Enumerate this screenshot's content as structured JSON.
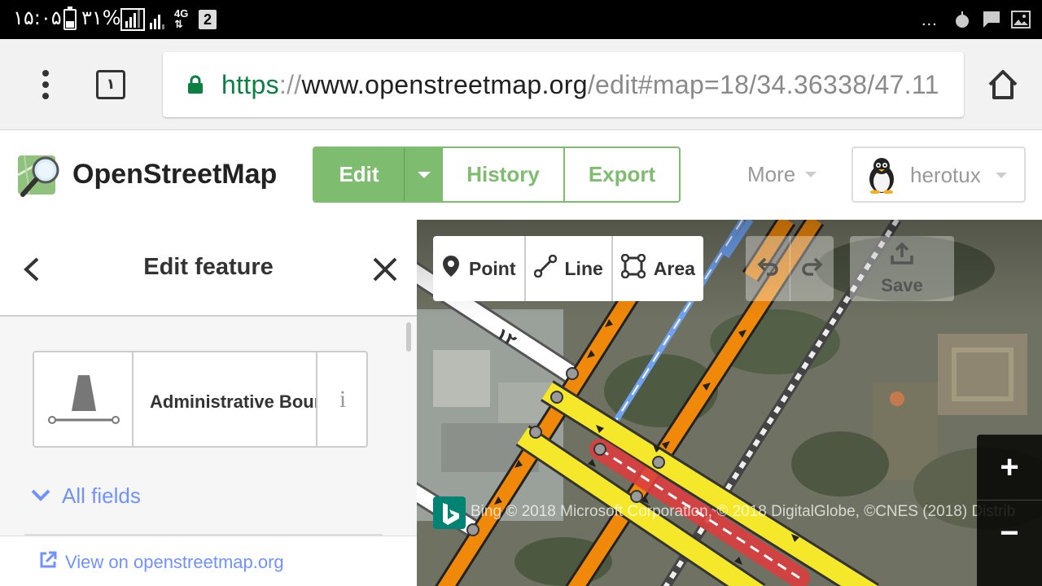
{
  "status_bar": {
    "time": "۱۵:۰۵",
    "battery": "۳۱%",
    "network": "4G",
    "sim_slot": "2",
    "overflow": "..."
  },
  "browser": {
    "tab_count": "۱",
    "url": {
      "scheme": "https",
      "separator": "://",
      "host": "www.openstreetmap.org",
      "path": "/edit#map=18/34.36338/47.11"
    }
  },
  "osm_header": {
    "site_title": "OpenStreetMap",
    "edit_label": "Edit",
    "history_label": "History",
    "export_label": "Export",
    "more_label": "More",
    "username": "herotux"
  },
  "sidebar": {
    "title": "Edit feature",
    "preset_name": "Administrative Boundary",
    "preset_info": "i",
    "all_fields_label": "All fields",
    "view_on_label": "View on openstreetmap.org"
  },
  "map": {
    "point_label": "Point",
    "line_label": "Line",
    "area_label": "Area",
    "save_label": "Save",
    "zoom_in": "+",
    "zoom_out": "−",
    "attribution": "Bing  © 2018 Microsoft Corporation, © 2018 DigitalGlobe, ©CNES (2018) Distrib",
    "road_label": "۱۲"
  },
  "colors": {
    "osm_green": "#7ebc6f",
    "link_blue": "#7092ff",
    "bing_teal": "#008373",
    "url_green": "#0b8043",
    "road_orange": "#f0880a",
    "road_yellow": "#f5e82a",
    "road_red": "#dc3f3f",
    "railway": "#555555"
  }
}
